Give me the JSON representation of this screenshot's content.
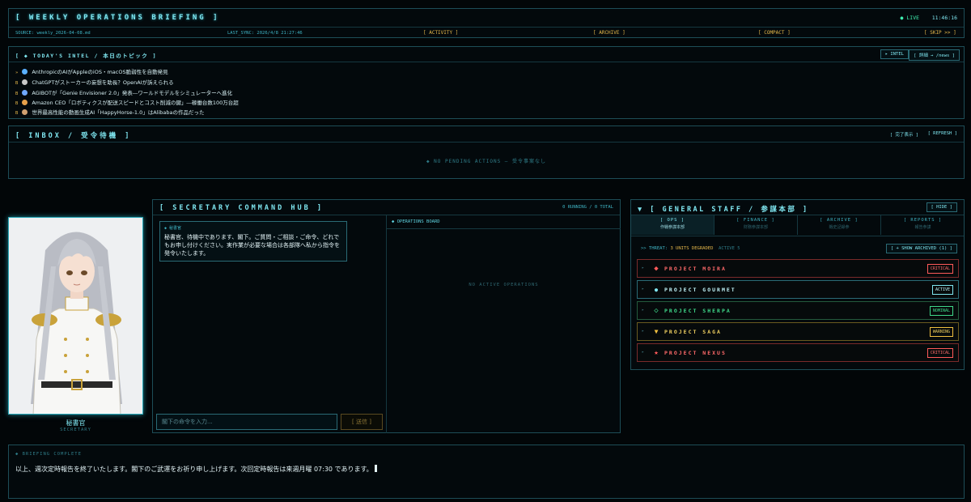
{
  "header": {
    "title": "[ WEEKLY OPERATIONS BRIEFING ]",
    "live_label": "● LIVE",
    "time": "11:46:16",
    "source": "SOURCE: weekly_2026-04-08.md",
    "last_sync": "LAST_SYNC: 2026/4/8 21:27:46",
    "nav": [
      "[ ACTIVITY ]",
      "[ ARCHIVE ]",
      "[ COMPACT ]",
      "[ SKIP >> ]"
    ]
  },
  "intel": {
    "title": "[ ◆ TODAY'S INTEL / 本日のトピック ]",
    "intel_button": "▸ INTEL",
    "detail_button": "[ 詳細 → /news ]",
    "items": [
      {
        "marker": "»",
        "icon": "shield-icon",
        "color": "#5ab0ff",
        "text": "AnthropicのAIがAppleのiOS・macOS脆弱性を自動発見"
      },
      {
        "marker": "B",
        "icon": "ghost-icon",
        "color": "#c8c8c8",
        "text": "ChatGPTがストーカーの妄想を助長？OpenAIが訴えられる"
      },
      {
        "marker": "B",
        "icon": "robot-icon",
        "color": "#6fa8ff",
        "text": "AGIBOTが「Genie Envisioner 2.0」発表―ワールドモデルをシミュレーターへ進化"
      },
      {
        "marker": "B",
        "icon": "box-icon",
        "color": "#e6a04a",
        "text": "Amazon CEO「ロボティクスが配送スピードとコスト削減の鍵」―稼働台数100万台超"
      },
      {
        "marker": "B",
        "icon": "video-icon",
        "color": "#d0a070",
        "text": "世界最高性能の動画生成AI「HappyHorse-1.0」はAlibabaの作品だった"
      }
    ]
  },
  "inbox": {
    "title": "[ INBOX / 受令待機 ]",
    "done_button": "[ 完了表示 ]",
    "refresh_button": "[ REFRESH ]",
    "empty": "◆ NO PENDING ACTIONS — 受令事案なし"
  },
  "secretary": {
    "name": "秘書官",
    "role": "SECRETARY"
  },
  "hub": {
    "title": "[ SECRETARY COMMAND HUB ]",
    "status": "0 RUNNING / 0 TOTAL",
    "bubble_label": "◆ 秘書官",
    "bubble_text": "秘書官、待機中であります、閣下。ご質問・ご相談・ご命令、どれでもお申し付けください。実作業が必要な場合は各部隊へ私から指令を発令いたします。",
    "ops_label": "◆ OPERATIONS BOARD",
    "ops_empty": "NO ACTIVE OPERATIONS",
    "input_placeholder": "閣下の命令を入力...",
    "send_label": "[ 送信 ]"
  },
  "staff": {
    "title": "▼ [ GENERAL STAFF / 参謀本部 ]",
    "hide_button": "[ HIDE ]",
    "tabs": [
      {
        "label": "[ OPS ]",
        "sub": "作戦参謀本部",
        "active": true
      },
      {
        "label": "[ FINANCE ]",
        "sub": "財務参謀本部",
        "active": false
      },
      {
        "label": "[ ARCHIVE ]",
        "sub": "戦史記録参",
        "active": false
      },
      {
        "label": "[ REPORTS ]",
        "sub": "報告参謀",
        "active": false
      }
    ],
    "threat_label": ">> THREAT:",
    "threat_value": "3 UNITS DEGRADED",
    "active_count": "ACTIVE 5",
    "show_archived": "[ + SHOW ARCHIVED (1) ]",
    "projects": [
      {
        "name": "PROJECT MOIRA",
        "status": "CRITICAL",
        "color": "#ff5a5a",
        "icon": "diamond-icon",
        "glyph": "◆"
      },
      {
        "name": "PROJECT GOURMET",
        "status": "ACTIVE",
        "color": "#7fe6f0",
        "icon": "dot-icon",
        "glyph": "●"
      },
      {
        "name": "PROJECT SHERPA",
        "status": "NOMINAL",
        "color": "#3fd98a",
        "icon": "diamond-outline-icon",
        "glyph": "◇"
      },
      {
        "name": "PROJECT SAGA",
        "status": "WARNING",
        "color": "#f0c040",
        "icon": "triangle-down-icon",
        "glyph": "▼"
      },
      {
        "name": "PROJECT NEXUS",
        "status": "CRITICAL",
        "color": "#ff5a5a",
        "icon": "star-icon",
        "glyph": "★"
      }
    ]
  },
  "footer": {
    "label": "◆ BRIEFING COMPLETE",
    "message": "以上、週次定時報告を終了いたします。閣下のご武運をお祈り申し上げます。次回定時報告は来週月曜 07:30 であります。"
  }
}
